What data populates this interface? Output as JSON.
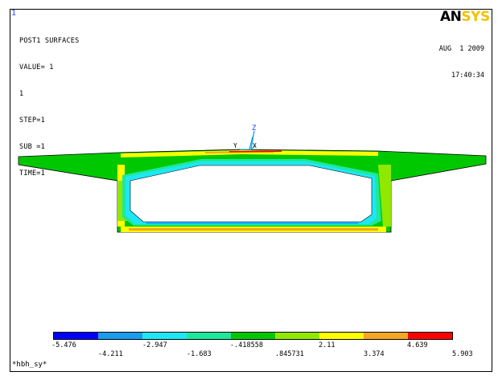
{
  "window": {
    "number": "1"
  },
  "info_lines": [
    "POST1 SURFACES",
    "VALUE= 1",
    "1",
    "STEP=1",
    "SUB =1",
    "TIME=1"
  ],
  "logo": {
    "an": "AN",
    "sys": "SYS"
  },
  "datetime": {
    "date": "AUG  1 2009",
    "time": "17:40:34"
  },
  "triad": {
    "z": "Z",
    "y": "Y",
    "x": "X"
  },
  "legend": {
    "colors": [
      "#0000ff",
      "#1a9cf0",
      "#1ee7f5",
      "#1de89b",
      "#00c800",
      "#90e800",
      "#ffff00",
      "#f5a623",
      "#ff0000"
    ],
    "labels_top": [
      "-5.476",
      "-2.947",
      "-.418558",
      "2.11",
      "4.639"
    ],
    "labels_bottom": [
      "-4.211",
      "-1.683",
      ".845731",
      "3.374",
      "5.903"
    ]
  },
  "jobname": "*hbh_sy*"
}
